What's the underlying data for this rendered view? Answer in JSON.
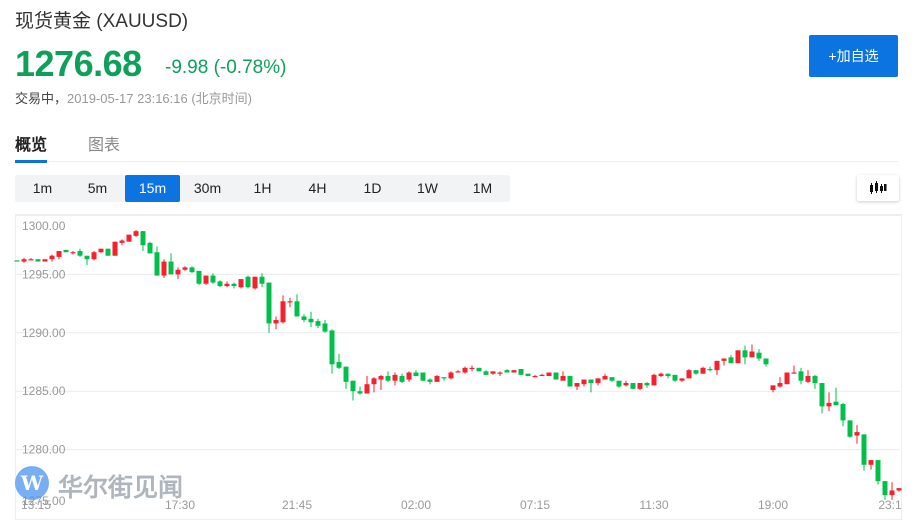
{
  "header": {
    "title": "现货黄金 (XAUUSD)",
    "price": "1276.68",
    "change": "-9.98 (-0.78%)",
    "status": "交易中，",
    "timestamp": "2019-05-17 23:16:16 (北京时间)",
    "add_button": "+加自选"
  },
  "tabs": [
    {
      "label": "概览",
      "active": true
    },
    {
      "label": "图表",
      "active": false
    }
  ],
  "periods": [
    {
      "label": "1m"
    },
    {
      "label": "5m"
    },
    {
      "label": "15m",
      "active": true
    },
    {
      "label": "30m"
    },
    {
      "label": "1H"
    },
    {
      "label": "4H"
    },
    {
      "label": "1D"
    },
    {
      "label": "1W"
    },
    {
      "label": "1M"
    }
  ],
  "chart_type_icon": "candlestick-icon",
  "watermark": "华尔街见闻",
  "colors": {
    "up": "#f5222d",
    "down": "#00c04b",
    "accent": "#0b74e0",
    "price": "#0ea05a"
  },
  "chart_data": {
    "type": "candlestick",
    "interval": "15m",
    "ylim": [
      1275,
      1300
    ],
    "y_ticks": [
      "1300.00",
      "1295.00",
      "1290.00",
      "1285.00",
      "1280.00",
      "1275.00"
    ],
    "x_ticks": [
      "13:15",
      "17:30",
      "21:45",
      "02:00",
      "07:15",
      "11:30",
      "19:00",
      "23:1"
    ],
    "grid": true,
    "ohlc": [
      [
        1296.2,
        1296.2,
        1296.1,
        1296.1
      ],
      [
        1296.1,
        1296.4,
        1296.0,
        1296.3
      ],
      [
        1296.2,
        1296.4,
        1296.2,
        1296.3
      ],
      [
        1296.3,
        1296.3,
        1296.1,
        1296.1
      ],
      [
        1296.1,
        1296.3,
        1296.1,
        1296.3
      ],
      [
        1296.3,
        1296.7,
        1296.1,
        1296.6
      ],
      [
        1296.5,
        1297.0,
        1296.3,
        1297.0
      ],
      [
        1297.1,
        1297.1,
        1296.9,
        1296.9
      ],
      [
        1296.9,
        1297.0,
        1296.7,
        1296.9
      ],
      [
        1297.0,
        1297.2,
        1296.5,
        1296.6
      ],
      [
        1296.6,
        1296.6,
        1295.8,
        1296.3
      ],
      [
        1296.3,
        1297.0,
        1296.2,
        1296.9
      ],
      [
        1296.9,
        1297.2,
        1296.8,
        1297.2
      ],
      [
        1297.2,
        1297.2,
        1296.6,
        1296.6
      ],
      [
        1296.6,
        1297.8,
        1296.6,
        1297.8
      ],
      [
        1297.7,
        1298.0,
        1297.5,
        1297.9
      ],
      [
        1297.8,
        1298.4,
        1297.8,
        1298.4
      ],
      [
        1298.3,
        1298.8,
        1298.2,
        1298.7
      ],
      [
        1298.7,
        1298.7,
        1297.0,
        1297.5
      ],
      [
        1297.7,
        1297.8,
        1296.8,
        1296.8
      ],
      [
        1296.9,
        1297.4,
        1294.9,
        1294.9
      ],
      [
        1294.9,
        1296.3,
        1294.7,
        1296.1
      ],
      [
        1296.1,
        1296.8,
        1295.0,
        1295.0
      ],
      [
        1295.0,
        1295.6,
        1294.6,
        1295.4
      ],
      [
        1295.4,
        1295.7,
        1295.3,
        1295.6
      ],
      [
        1295.6,
        1295.7,
        1295.1,
        1295.2
      ],
      [
        1295.3,
        1295.3,
        1294.1,
        1294.2
      ],
      [
        1294.2,
        1294.9,
        1294.1,
        1294.9
      ],
      [
        1294.9,
        1295.1,
        1294.2,
        1294.3
      ],
      [
        1294.4,
        1294.5,
        1293.9,
        1294.0
      ],
      [
        1294.0,
        1294.4,
        1293.9,
        1294.2
      ],
      [
        1294.2,
        1294.3,
        1293.8,
        1294.0
      ],
      [
        1293.9,
        1294.6,
        1293.8,
        1294.6
      ],
      [
        1294.8,
        1294.9,
        1293.8,
        1293.9
      ],
      [
        1293.8,
        1294.8,
        1293.7,
        1294.8
      ],
      [
        1294.8,
        1295.1,
        1293.9,
        1294.2
      ],
      [
        1294.3,
        1294.3,
        1290.0,
        1290.8
      ],
      [
        1290.8,
        1291.4,
        1290.3,
        1291.1
      ],
      [
        1290.9,
        1293.2,
        1290.8,
        1292.7
      ],
      [
        1292.6,
        1293.0,
        1292.2,
        1292.7
      ],
      [
        1292.7,
        1293.3,
        1291.4,
        1291.4
      ],
      [
        1291.4,
        1291.6,
        1290.9,
        1291.1
      ],
      [
        1291.2,
        1291.8,
        1290.5,
        1290.9
      ],
      [
        1291.0,
        1291.2,
        1290.4,
        1290.6
      ],
      [
        1290.8,
        1291.1,
        1290.0,
        1290.1
      ],
      [
        1290.2,
        1290.3,
        1286.5,
        1287.3
      ],
      [
        1287.5,
        1288.2,
        1286.9,
        1287.0
      ],
      [
        1287.1,
        1287.1,
        1285.2,
        1285.8
      ],
      [
        1285.9,
        1285.9,
        1284.2,
        1285.0
      ],
      [
        1285.0,
        1285.4,
        1284.7,
        1284.8
      ],
      [
        1284.8,
        1286.3,
        1284.8,
        1285.6
      ],
      [
        1285.6,
        1286.2,
        1284.9,
        1286.1
      ],
      [
        1286.0,
        1286.4,
        1285.1,
        1286.3
      ],
      [
        1286.3,
        1286.7,
        1285.8,
        1285.9
      ],
      [
        1285.9,
        1286.6,
        1285.5,
        1286.4
      ],
      [
        1286.3,
        1286.5,
        1285.7,
        1285.8
      ],
      [
        1286.0,
        1286.7,
        1285.8,
        1286.6
      ],
      [
        1286.6,
        1286.8,
        1286.3,
        1286.3
      ],
      [
        1286.6,
        1286.6,
        1285.9,
        1285.9
      ],
      [
        1286.0,
        1286.1,
        1285.6,
        1285.8
      ],
      [
        1285.8,
        1286.4,
        1285.8,
        1286.3
      ],
      [
        1286.2,
        1286.2,
        1285.9,
        1286.1
      ],
      [
        1286.1,
        1286.7,
        1286.0,
        1286.6
      ],
      [
        1286.6,
        1286.8,
        1286.6,
        1286.7
      ],
      [
        1286.6,
        1287.1,
        1286.5,
        1287.0
      ],
      [
        1287.0,
        1287.2,
        1286.7,
        1287.0
      ],
      [
        1287.0,
        1287.0,
        1286.7,
        1286.7
      ],
      [
        1286.7,
        1286.8,
        1286.4,
        1286.4
      ],
      [
        1286.5,
        1286.7,
        1286.4,
        1286.7
      ],
      [
        1286.5,
        1286.7,
        1286.3,
        1286.6
      ],
      [
        1286.8,
        1286.9,
        1286.6,
        1286.6
      ],
      [
        1286.6,
        1286.8,
        1286.6,
        1286.8
      ],
      [
        1286.9,
        1286.9,
        1286.4,
        1286.4
      ],
      [
        1286.5,
        1286.5,
        1286.3,
        1286.3
      ],
      [
        1286.3,
        1286.4,
        1286.2,
        1286.3
      ],
      [
        1286.3,
        1286.5,
        1286.3,
        1286.4
      ],
      [
        1286.3,
        1286.6,
        1286.3,
        1286.6
      ],
      [
        1286.6,
        1286.6,
        1286.0,
        1286.0
      ],
      [
        1285.9,
        1286.7,
        1285.9,
        1286.3
      ],
      [
        1286.3,
        1286.3,
        1285.4,
        1285.4
      ],
      [
        1285.4,
        1285.7,
        1285.1,
        1285.7
      ],
      [
        1285.6,
        1286.0,
        1285.4,
        1286.0
      ],
      [
        1286.0,
        1286.0,
        1284.9,
        1285.7
      ],
      [
        1285.7,
        1286.1,
        1285.5,
        1286.1
      ],
      [
        1286.0,
        1286.5,
        1286.0,
        1286.3
      ],
      [
        1286.2,
        1286.2,
        1285.8,
        1285.9
      ],
      [
        1285.9,
        1285.9,
        1285.3,
        1285.4
      ],
      [
        1285.5,
        1285.9,
        1285.4,
        1285.7
      ],
      [
        1285.7,
        1285.7,
        1285.2,
        1285.2
      ],
      [
        1285.2,
        1285.7,
        1285.1,
        1285.7
      ],
      [
        1285.7,
        1285.8,
        1285.3,
        1285.5
      ],
      [
        1285.5,
        1286.5,
        1285.5,
        1286.4
      ],
      [
        1286.3,
        1286.6,
        1286.2,
        1286.5
      ],
      [
        1286.5,
        1286.5,
        1286.1,
        1286.3
      ],
      [
        1286.4,
        1286.4,
        1285.8,
        1285.9
      ],
      [
        1285.9,
        1286.1,
        1285.8,
        1286.1
      ],
      [
        1286.1,
        1286.9,
        1286.1,
        1286.8
      ],
      [
        1286.8,
        1286.8,
        1286.4,
        1286.5
      ],
      [
        1286.5,
        1287.1,
        1286.5,
        1287.0
      ],
      [
        1286.9,
        1287.1,
        1286.7,
        1286.8
      ],
      [
        1286.8,
        1287.6,
        1286.4,
        1287.6
      ],
      [
        1287.6,
        1287.8,
        1287.2,
        1287.8
      ],
      [
        1287.9,
        1288.1,
        1287.4,
        1287.4
      ],
      [
        1287.4,
        1288.5,
        1287.4,
        1288.5
      ],
      [
        1288.5,
        1288.9,
        1287.3,
        1287.9
      ],
      [
        1287.9,
        1289.0,
        1287.9,
        1288.4
      ],
      [
        1288.3,
        1288.6,
        1287.6,
        1287.8
      ],
      [
        1287.8,
        1287.8,
        1287.1,
        1287.3
      ],
      [
        1285.1,
        1285.5,
        1284.9,
        1285.5
      ],
      [
        1285.4,
        1286.2,
        1285.3,
        1285.7
      ],
      [
        1285.6,
        1286.6,
        1285.6,
        1286.6
      ],
      [
        1286.6,
        1287.2,
        1286.6,
        1286.6
      ],
      [
        1286.7,
        1287.0,
        1285.6,
        1285.9
      ],
      [
        1285.8,
        1286.8,
        1285.7,
        1286.3
      ],
      [
        1286.3,
        1286.4,
        1285.2,
        1285.7
      ],
      [
        1285.7,
        1285.7,
        1283.1,
        1283.7
      ],
      [
        1283.7,
        1284.9,
        1283.3,
        1284.0
      ],
      [
        1284.1,
        1285.3,
        1283.8,
        1283.8
      ],
      [
        1283.9,
        1284.0,
        1282.0,
        1282.5
      ],
      [
        1282.5,
        1282.5,
        1281.0,
        1281.1
      ],
      [
        1281.2,
        1282.1,
        1280.5,
        1281.5
      ],
      [
        1281.3,
        1281.3,
        1278.2,
        1278.7
      ],
      [
        1278.7,
        1279.1,
        1278.3,
        1279.1
      ],
      [
        1279.1,
        1279.1,
        1277.0,
        1277.3
      ],
      [
        1277.3,
        1277.3,
        1275.7,
        1276.1
      ],
      [
        1276.1,
        1277.2,
        1275.7,
        1276.5
      ],
      [
        1276.5,
        1276.7,
        1276.4,
        1276.7
      ]
    ]
  }
}
